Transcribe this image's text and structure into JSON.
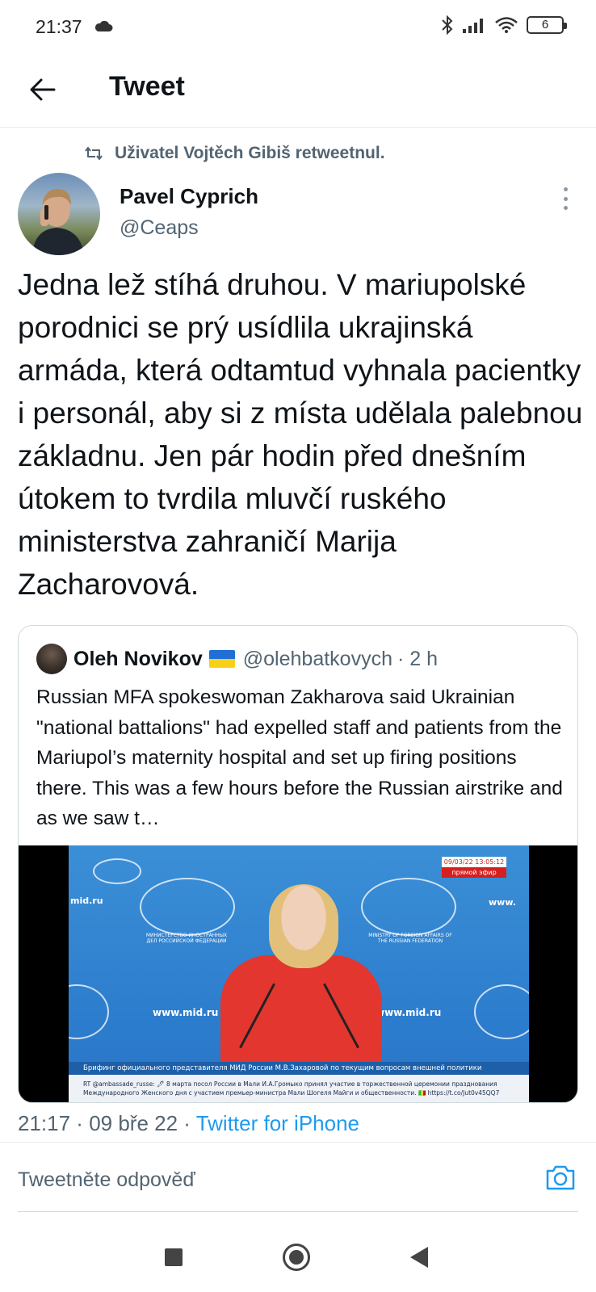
{
  "status_bar": {
    "time": "21:37",
    "battery_level": "6",
    "icons": [
      "cloud-icon",
      "bluetooth-icon",
      "signal-icon",
      "wifi-icon",
      "battery-icon"
    ]
  },
  "header": {
    "title": "Tweet",
    "back_icon": "arrow-left-icon"
  },
  "retweet": {
    "icon": "retweet-icon",
    "text": "Uživatel Vojtěch Gibiš retweetnul."
  },
  "author": {
    "name": "Pavel Cyprich",
    "handle": "@Ceaps"
  },
  "tweet": {
    "text": "Jedna lež stíhá druhou. V mariupolské porodnici se prý usídlila ukrajinská armáda, která odtamtud vyhnala pacientky i personál, aby si z místa udělala palebnou základnu. Jen pár hodin před dnešním útokem to tvrdila mluvčí ruského ministerstva zahraničí Marija Zacharovová."
  },
  "quote": {
    "name": "Oleh Novikov",
    "flag": "ukraine-flag-icon",
    "handle": "@olehbatkovych",
    "time": "· 2 h",
    "text": "Russian MFA spokeswoman Zakharova said Ukrainian \"national battalions\" had expelled staff and patients from the Mariupol’s maternity hospital and set up firing positions there. This was a few hours before the Russian airstrike and as we saw t…",
    "media": {
      "site_left": "mid.ru",
      "site_right": "www.",
      "url_left": "www.mid.ru",
      "url_right": "www.mid.ru",
      "ministry_ru": "МИНИСТЕРСТВО ИНОСТРАННЫХ ДЕЛ РОССИЙСКОЙ ФЕДЕРАЦИИ",
      "ministry_en": "MINISTRY OF FOREIGN AFFAIRS OF THE RUSSIAN FEDERATION",
      "live_date": "09/03/22  13:05:12",
      "live_label": "прямой эфир",
      "ticker_main": "Брифинг официального представителя МИД России М.В.Захаровой по текущим вопросам внешней политики",
      "ticker_sub1": "RT @ambassade_russe: 🖊 8 марта посол России в Мали И.А.Громыко принял участие в торжественной церемонии празднования",
      "ticker_sub2": "Международного Женского дня с участием премьер-министра Мали Шогеля Майги и общественности. 🇲🇱 https://t.co/Jut0v45QQ7"
    }
  },
  "meta": {
    "time": "21:17",
    "sep1": " · ",
    "date": "09 bře 22",
    "sep2": " · ",
    "source": "Twitter for iPhone"
  },
  "reply": {
    "placeholder": "Tweetněte odpověď",
    "camera_icon": "camera-icon"
  },
  "nav": {
    "icons": [
      "recents-square-icon",
      "home-circle-icon",
      "back-triangle-icon"
    ]
  }
}
